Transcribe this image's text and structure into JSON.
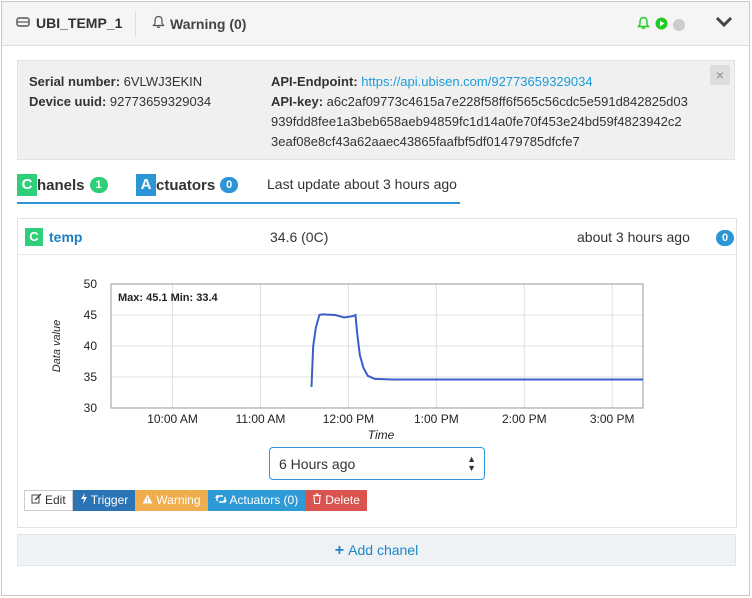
{
  "header": {
    "device_name": "UBI_TEMP_1",
    "warning_label": "Warning (0)",
    "status_colors": {
      "bell": "#22cc22",
      "play": "#22cc22",
      "idle": "#cccccc"
    }
  },
  "info": {
    "serial_label": "Serial number:",
    "serial_value": "6VLWJ3EKIN",
    "uuid_label": "Device uuid:",
    "uuid_value": "92773659329034",
    "endpoint_label": "API-Endpoint:",
    "endpoint_value": "https://api.ubisen.com/92773659329034",
    "key_label": "API-key:",
    "key_line1": "a6c2af09773c4615a7e228f58ff6f565c56cdc5e591d842825d03",
    "key_line2": "939fdd8fee1a3beb658aeb94859fc1d14a0fe70f453e24bd59f4823942c2",
    "key_line3": "3eaf08e8cf43a62aaec43865faafbf5df01479785dfcfe7",
    "close_label": "×"
  },
  "tabs": {
    "chanels_letter": "C",
    "chanels_rest": "hanels",
    "chanels_count": "1",
    "actuators_letter": "A",
    "actuators_rest": "ctuators",
    "actuators_count": "0",
    "last_update": "Last update about 3 hours ago"
  },
  "channel": {
    "letter": "C",
    "name": "temp",
    "value": "34.6 (0C)",
    "time": "about 3 hours ago",
    "count": "0"
  },
  "chart_data": {
    "type": "line",
    "title": "",
    "annotation": "Max: 45.1 Min: 33.4",
    "xlabel": "Time",
    "ylabel": "Data value",
    "ylim": [
      30,
      50
    ],
    "yticks": [
      30,
      35,
      40,
      45,
      50
    ],
    "xticks": [
      "10:00 AM",
      "11:00 AM",
      "12:00 PM",
      "1:00 PM",
      "2:00 PM",
      "3:00 PM"
    ],
    "xlim_hours": [
      9.3,
      15.35
    ],
    "grid": true,
    "color": "#3b5fc9",
    "series": [
      {
        "x": [
          11.58,
          11.6,
          11.63,
          11.67,
          11.7,
          11.85,
          11.9,
          11.95,
          12.05,
          12.08,
          12.1,
          12.13,
          12.17,
          12.22,
          12.3,
          12.5,
          13.0,
          14.0,
          15.0,
          15.35
        ],
        "y": [
          33.4,
          40.0,
          43.0,
          45.0,
          45.1,
          45.0,
          44.8,
          44.6,
          44.8,
          45.0,
          42.0,
          38.5,
          36.5,
          35.2,
          34.7,
          34.6,
          34.6,
          34.6,
          34.6,
          34.6
        ]
      }
    ]
  },
  "range_select": {
    "value": "6 Hours ago"
  },
  "buttons": {
    "edit": "Edit",
    "trigger": "Trigger",
    "warning": "Warning",
    "actuators": "Actuators (0)",
    "delete": "Delete"
  },
  "add_chanel": "Add chanel"
}
